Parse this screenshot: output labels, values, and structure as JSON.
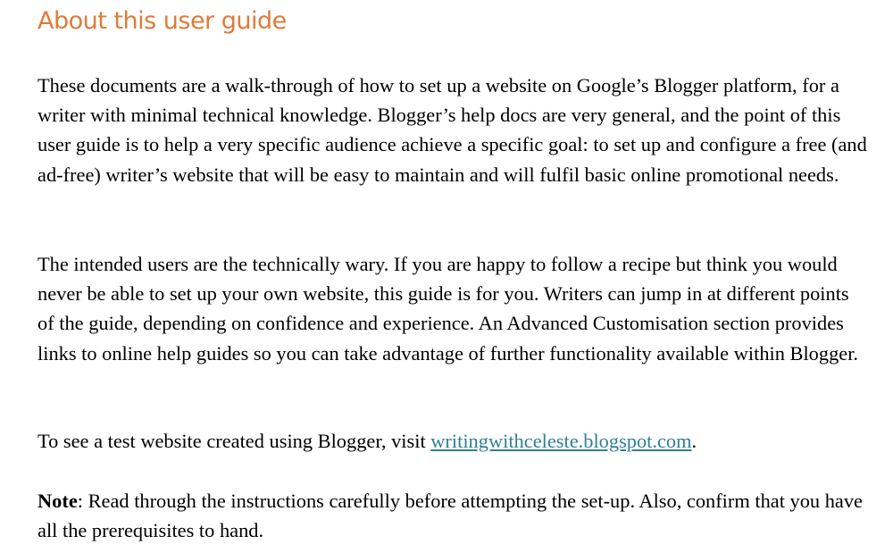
{
  "heading": "About this user guide",
  "paragraphs": {
    "intro": "These documents are a walk-through of how to set up a website on Google’s Blogger platform, for a writer with minimal technical knowledge. Blogger’s help docs are very general, and the point of this user guide is to help a very specific audience achieve a specific goal: to set up and configure a free (and ad-free) writer’s website that will be easy to maintain and will fulfil basic online promotional needs.",
    "audience": "The intended users are the technically wary. If you are happy to follow a recipe but think you would never be able to set up your own website, this guide is for you. Writers can jump in at different points of the guide, depending on confidence and experience. An Advanced Customisation section provides links to online help guides so you can take advantage of further functionality available within Blogger.",
    "test_site_prefix": "To see a test website created using Blogger, visit ",
    "test_site_link": "writingwithceleste.blogspot.com",
    "test_site_suffix": ".",
    "note_label": "Note",
    "note_text": ": Read through the instructions carefully before attempting the set-up. Also, confirm that you have all the prerequisites to hand."
  },
  "colors": {
    "heading": "#e07b39",
    "link": "#2f7f9a"
  }
}
